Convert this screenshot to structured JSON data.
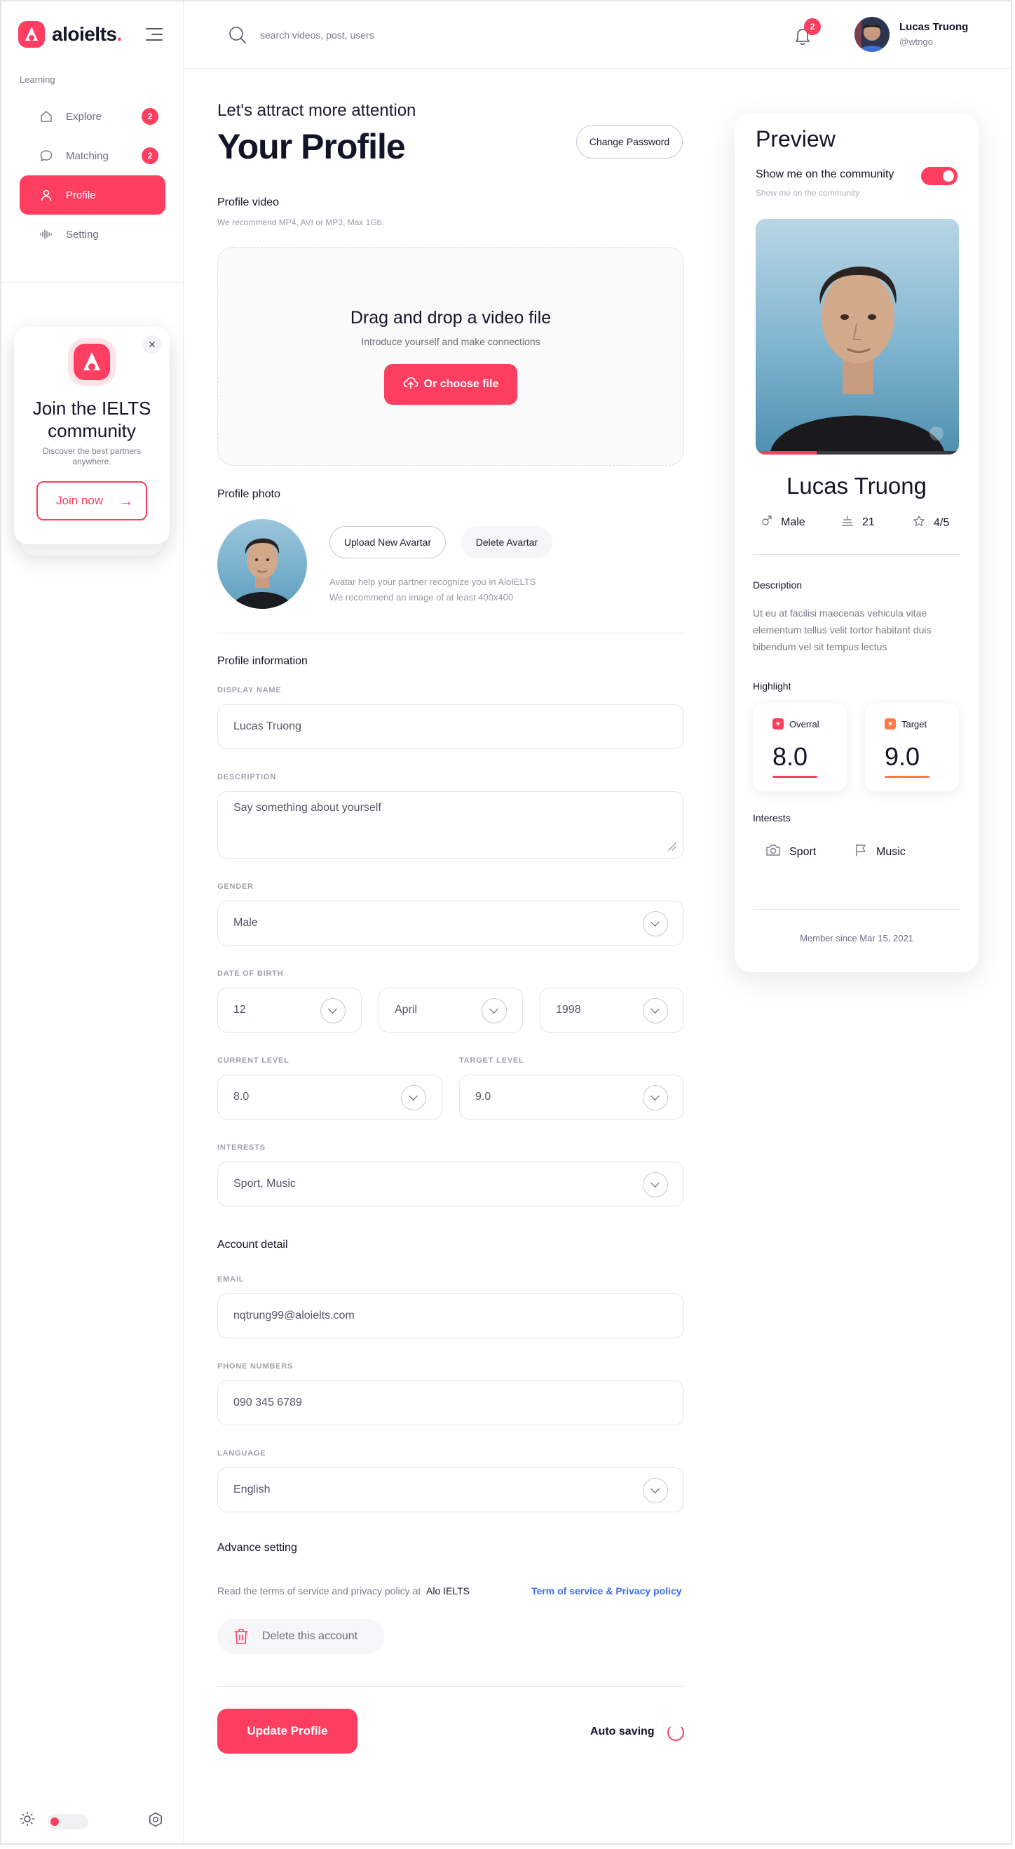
{
  "app": {
    "brand": "aloielts",
    "brand_dot": "."
  },
  "sidebar": {
    "section_label": "Learning",
    "items": [
      {
        "label": "Explore",
        "icon": "home-icon",
        "badge": "2",
        "active": false
      },
      {
        "label": "Matching",
        "icon": "chat-icon",
        "badge": "2",
        "active": true
      },
      {
        "label": "Profile",
        "icon": "user-icon",
        "badge": "",
        "active": true
      },
      {
        "label": "Setting",
        "icon": "waveform-icon",
        "badge": "",
        "active": false
      }
    ],
    "promo": {
      "title": "Join the IELTS community",
      "subtitle": "Discover the best partners anywhere.",
      "button": "Join now"
    }
  },
  "topbar": {
    "search_placeholder": "search videos, post, users",
    "notification_count": "2",
    "user_name": "Lucas Truong",
    "user_handle": "@wtngo"
  },
  "main": {
    "subtitle": "Let's attract more attention",
    "title": "Your Profile",
    "change_password": "Change Password",
    "video": {
      "title": "Profile video",
      "hint": "We recommend MP4, AVI or MP3, Max 1Gb.",
      "drop_title": "Drag and drop a video file",
      "drop_sub": "Introduce yourself and make connections",
      "choose_button": "Or choose file"
    },
    "photo": {
      "title": "Profile photo",
      "upload_button": "Upload New Avartar",
      "delete_button": "Delete Avartar",
      "hint1": "Avatar help your partner recognize you in AloIELTS",
      "hint2": "We recommend an image of at least 400x400"
    },
    "info": {
      "title": "Profile information",
      "display_name_label": "DISPLAY NAME",
      "display_name": "Lucas Truong",
      "description_label": "DESCRIPTION",
      "description_placeholder": "Say something about yourself",
      "gender_label": "GENDER",
      "gender": "Male",
      "dob_label": "DATE OF BIRTH",
      "dob_day": "12",
      "dob_month": "April",
      "dob_year": "1998",
      "current_level_label": "CURRENT LEVEL",
      "current_level": "8.0",
      "target_level_label": "TARGET LEVEL",
      "target_level": "9.0",
      "interests_label": "INTERESTS",
      "interests": "Sport, Music"
    },
    "account": {
      "title": "Account  detail",
      "email_label": "EMAIL",
      "email": "nqtrung99@aloielts.com",
      "phone_label": "PHONE NUMBERS",
      "phone": "090 345 6789",
      "language_label": "LANGUAGE",
      "language": "English"
    },
    "advance": {
      "title": "Advance setting",
      "terms_text": "Read the terms of service and privacy policy at",
      "terms_brand": "Alo IELTS",
      "terms_link": "Term of service & Privacy policy",
      "delete_account": "Delete this account"
    },
    "update_button": "Update Profile",
    "auto_saving": "Auto saving"
  },
  "preview": {
    "title": "Preview",
    "show_label": "Show me on the community",
    "show_sub": "Show me on the community",
    "video_progress": 0.3,
    "name": "Lucas Truong",
    "gender": "Male",
    "age": "21",
    "rating": "4/5",
    "description_title": "Description",
    "description": "Ut eu at facilisi maecenas vehicula vitae elementum tellus velit tortor habitant duis bibendum vel sit tempus lectus",
    "highlight_title": "Highlight",
    "highlights": [
      {
        "label": "Overral",
        "value": "8.0",
        "color": "#fd3e60"
      },
      {
        "label": "Target",
        "value": "9.0",
        "color": "#ff7a45"
      }
    ],
    "interests_title": "Interests",
    "interests": [
      {
        "label": "Sport",
        "icon": "camera-icon"
      },
      {
        "label": "Music",
        "icon": "flag-icon"
      }
    ],
    "member_since": "Member since Mar 15, 2021"
  },
  "colors": {
    "accent": "#fd3e60",
    "link": "#3a6df0"
  }
}
